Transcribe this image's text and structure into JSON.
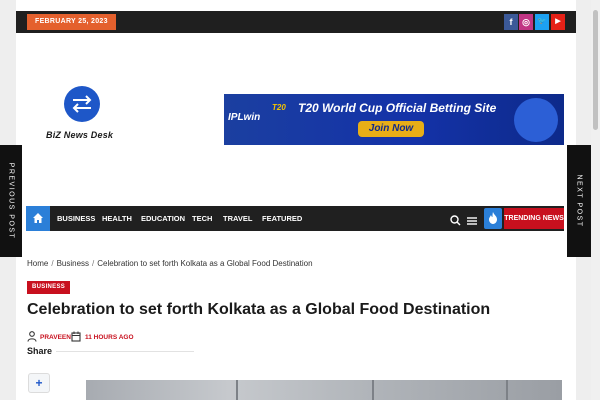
{
  "topbar": {
    "date": "FEBRUARY 25, 2023",
    "social": [
      {
        "name": "facebook",
        "glyph": "f",
        "color": "#3b5998"
      },
      {
        "name": "instagram",
        "glyph": "◎",
        "color": "#c13584"
      },
      {
        "name": "twitter",
        "glyph": "🐦",
        "color": "#1da1f2"
      },
      {
        "name": "youtube",
        "glyph": "▶",
        "color": "#e62117"
      }
    ]
  },
  "logo": {
    "text": "BiZ News Desk"
  },
  "ad": {
    "brand": "IPLwin",
    "badge": "T20",
    "headline": "T20 World Cup Official Betting Site",
    "button": "Join Now"
  },
  "side": {
    "prev": "PREVIOUS POST",
    "next": "NEXT POST"
  },
  "nav": {
    "items": [
      "BUSINESS",
      "HEALTH",
      "EDUCATION",
      "TECH",
      "TRAVEL",
      "FEATURED"
    ],
    "trending": "TRENDING NEWS"
  },
  "breadcrumb": [
    "Home",
    "Business",
    "Celebration to set forth Kolkata as a Global Food Destination"
  ],
  "article": {
    "category": "BUSINESS",
    "title": "Celebration to set forth Kolkata as a Global Food Destination",
    "author": "PRAVEEN",
    "time": "11 HOURS AGO",
    "share_label": "Share",
    "plus": "+"
  },
  "colors": {
    "accent_blue": "#2b7fd8",
    "accent_red": "#c8101e",
    "date_orange": "#e4602d",
    "dark_bar": "#202020"
  }
}
